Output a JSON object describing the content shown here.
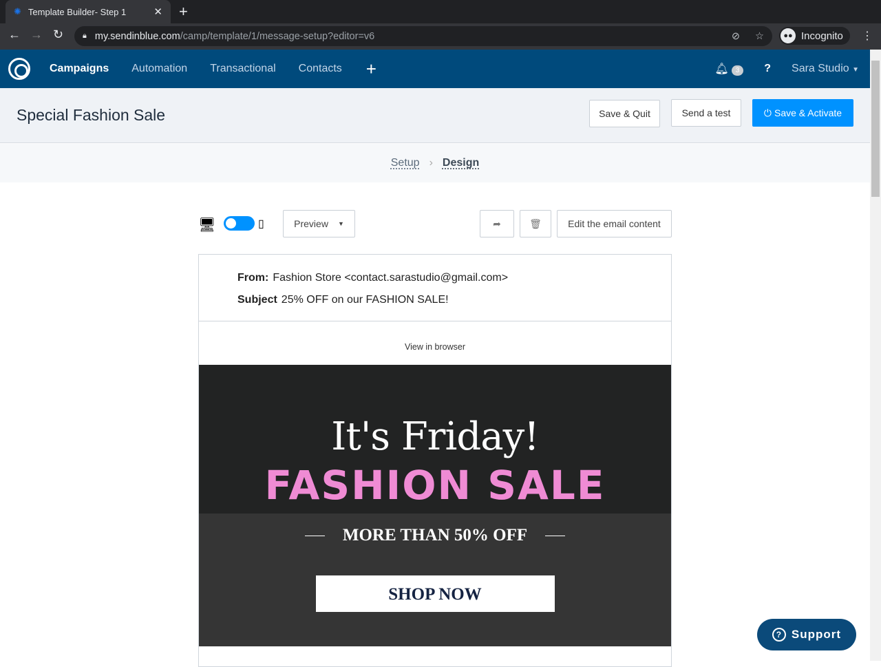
{
  "browser": {
    "tab_title": "Template Builder- Step 1",
    "url_host": "my.sendinblue.com",
    "url_path": "/camp/template/1/message-setup?editor=v6",
    "profile": "Incognito"
  },
  "nav": {
    "items": [
      "Campaigns",
      "Automation",
      "Transactional",
      "Contacts"
    ],
    "notifications": "3",
    "user": "Sara Studio"
  },
  "header": {
    "title": "Special Fashion Sale",
    "save_quit": "Save & Quit",
    "send_test": "Send a test",
    "save_activate": "Save & Activate"
  },
  "steps": {
    "setup": "Setup",
    "design": "Design"
  },
  "toolbar": {
    "preview": "Preview",
    "edit": "Edit the email content"
  },
  "email": {
    "from_label": "From:",
    "from": "Fashion Store <contact.sarastudio@gmail.com>",
    "subject_label": "Subject",
    "subject": "25% OFF on our FASHION SALE!",
    "view_browser": "View in browser",
    "headline": "It's Friday!",
    "sale": "FASHION SALE",
    "offer": "MORE THAN 50% OFF",
    "cta": "SHOP NOW"
  },
  "support": "Support",
  "colors": {
    "nav": "#004a7c",
    "accent": "#0092ff",
    "pink": "#ef8bd4"
  }
}
